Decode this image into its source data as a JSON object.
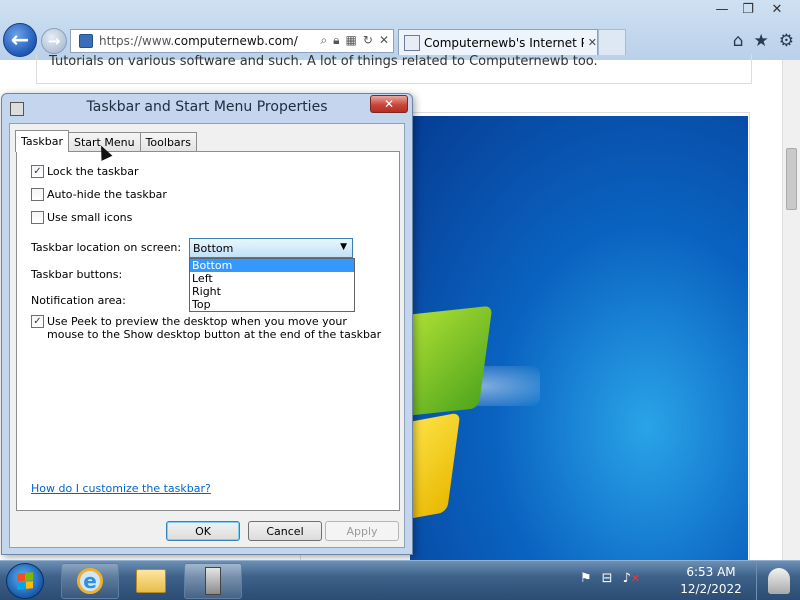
{
  "window": {
    "minimize_glyph": "—",
    "restore_glyph": "❐",
    "close_glyph": "✕"
  },
  "browser": {
    "url_scheme": "https://www.",
    "url_host": "computernewb.com/",
    "tab_title": "Computernewb's Internet P...",
    "tab_close_glyph": "✕",
    "back_glyph": "←",
    "forward_glyph": "→",
    "address_icons": [
      "search-icon",
      "lock-icon",
      "compat-icon",
      "refresh-icon",
      "stop-icon"
    ],
    "command_icons": [
      "home-icon",
      "favorites-icon",
      "tools-icon"
    ]
  },
  "page": {
    "text": "Tutorials on various software and such. A lot of things related to Computernewb too."
  },
  "dialog": {
    "title": "Taskbar and Start Menu Properties",
    "close_glyph": "✕",
    "tabs": [
      {
        "label": "Taskbar",
        "active": true
      },
      {
        "label": "Start Menu",
        "active": false
      },
      {
        "label": "Toolbars",
        "active": false
      }
    ],
    "lock_taskbar": {
      "label": "Lock the taskbar",
      "checked": true,
      "mark": "✓"
    },
    "auto_hide": {
      "label": "Auto-hide the taskbar",
      "checked": false,
      "mark": ""
    },
    "small_icons": {
      "label": "Use small icons",
      "checked": false,
      "mark": ""
    },
    "location": {
      "label": "Taskbar location on screen:",
      "value": "Bottom",
      "arrow": "▼",
      "options": [
        "Bottom",
        "Left",
        "Right",
        "Top"
      ],
      "highlighted": "Bottom"
    },
    "taskbar_buttons": {
      "label": "Taskbar buttons:"
    },
    "notification_area": {
      "label": "Notification area:"
    },
    "peek": {
      "label": "Use Peek to preview the desktop when you move your mouse to the Show desktop button at the end of the taskbar",
      "checked": true,
      "mark": "✓"
    },
    "help_link": "How do I customize the taskbar?",
    "buttons": {
      "ok": "OK",
      "cancel": "Cancel",
      "apply": "Apply"
    }
  },
  "taskbar": {
    "pinned": [
      "internet-explorer",
      "windows-explorer",
      "taskbar-properties"
    ],
    "ie_glyph": "e",
    "tray": {
      "flag": "⚑",
      "network": "⊟",
      "volume": "♪",
      "volume_muted_mark": "✕"
    },
    "clock": {
      "time": "6:53 AM",
      "date": "12/2/2022"
    }
  },
  "colors": {
    "selection": "#3399ff",
    "link": "#0066cc",
    "taskbar": "#3d6189",
    "dialog_frame": "#c3d6ee"
  }
}
